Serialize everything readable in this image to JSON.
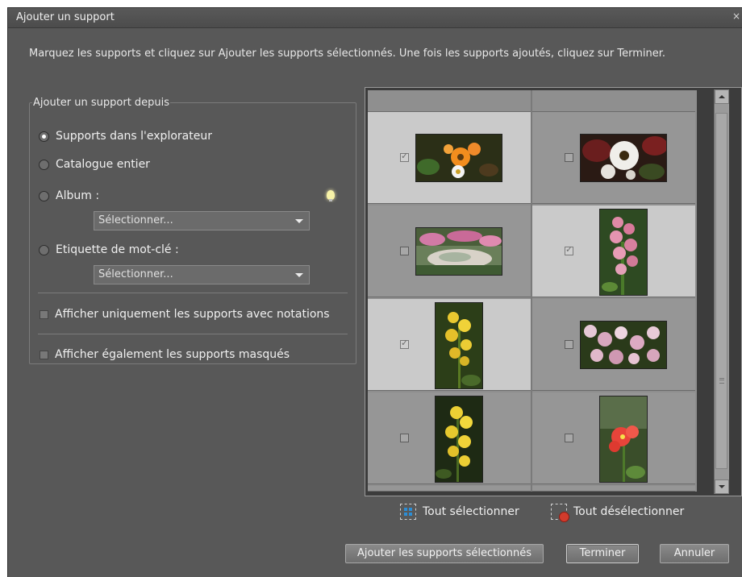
{
  "window": {
    "title": "Ajouter un support",
    "close_glyph": "×"
  },
  "instructions": "Marquez les supports et cliquez sur Ajouter les supports sélectionnés. Une fois les supports ajoutés, cliquez sur Terminer.",
  "source_group": {
    "legend": "Ajouter un support depuis",
    "options": [
      {
        "label": "Supports dans l'explorateur",
        "checked": true
      },
      {
        "label": "Catalogue entier",
        "checked": false
      },
      {
        "label": "Album :",
        "checked": false
      },
      {
        "label": "Etiquette de mot-clé :",
        "checked": false
      }
    ],
    "album_select": "Sélectionner...",
    "keyword_select": "Sélectionner...",
    "rated_only_label": "Afficher uniquement les supports avec notations",
    "hidden_label": "Afficher également les supports masqués",
    "hint_icon": "lightbulb-icon"
  },
  "grid": {
    "items": [
      {
        "checked": true,
        "selected": true,
        "subject": "orange and white gerbera flowers"
      },
      {
        "checked": false,
        "selected": false,
        "subject": "white gerbera flower"
      },
      {
        "checked": false,
        "selected": false,
        "subject": "flower garden pond"
      },
      {
        "checked": true,
        "selected": true,
        "subject": "pink orchids"
      },
      {
        "checked": true,
        "selected": true,
        "subject": "yellow orchids"
      },
      {
        "checked": false,
        "selected": false,
        "subject": "pink and white orchids"
      },
      {
        "checked": false,
        "selected": false,
        "subject": "yellow orchid spike"
      },
      {
        "checked": false,
        "selected": false,
        "subject": "red orchid"
      }
    ]
  },
  "actions": {
    "select_all": "Tout sélectionner",
    "deselect_all": "Tout désélectionner",
    "add_selected": "Ajouter les supports sélectionnés",
    "done": "Terminer",
    "cancel": "Annuler"
  },
  "colors": {
    "dialog_bg": "#585858",
    "selected_cell": "#cacaca",
    "unselected_cell": "#969696"
  }
}
